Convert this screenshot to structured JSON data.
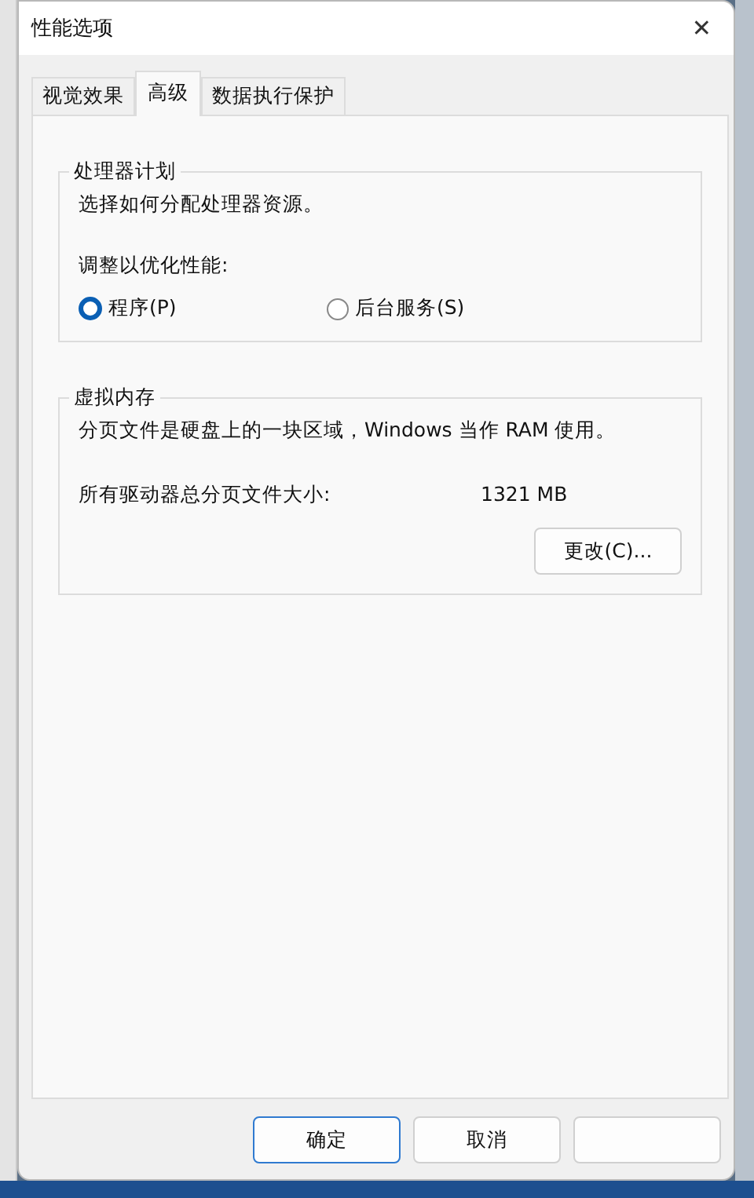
{
  "window": {
    "title": "性能选项",
    "close": "✕"
  },
  "tabs": [
    {
      "label": "视觉效果",
      "selected": false
    },
    {
      "label": "高级",
      "selected": true
    },
    {
      "label": "数据执行保护",
      "selected": false
    }
  ],
  "processor_scheduling": {
    "title": "处理器计划",
    "description": "选择如何分配处理器资源。",
    "adjust_label": "调整以优化性能:",
    "options": [
      {
        "label": "程序(P)",
        "selected": true
      },
      {
        "label": "后台服务(S)",
        "selected": false
      }
    ]
  },
  "virtual_memory": {
    "title": "虚拟内存",
    "description": "分页文件是硬盘上的一块区域，Windows 当作 RAM 使用。",
    "total_label": "所有驱动器总分页文件大小:",
    "total_value": "1321 MB",
    "change_button": "更改(C)..."
  },
  "buttons": [
    {
      "label": "确定",
      "kind": "default"
    },
    {
      "label": "取消",
      "kind": "normal"
    }
  ]
}
